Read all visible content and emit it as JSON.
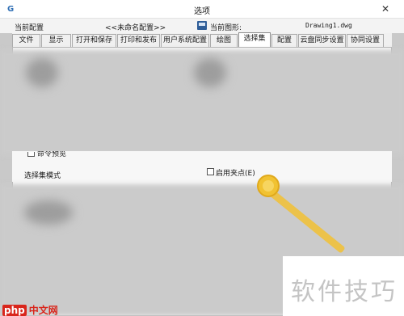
{
  "window": {
    "title": "选项",
    "close_glyph": "✕"
  },
  "profile": {
    "current_profile_label": "当前配置",
    "current_profile_value": "<<未命名配置>>",
    "current_drawing_label": "当前图形:",
    "current_drawing_value": "Drawing1.dwg"
  },
  "tabs": [
    {
      "label": "文件"
    },
    {
      "label": "显示"
    },
    {
      "label": "打开和保存"
    },
    {
      "label": "打印和发布"
    },
    {
      "label": "用户系统配置"
    },
    {
      "label": "绘图"
    },
    {
      "label": "选择集",
      "active": true
    },
    {
      "label": "配置"
    },
    {
      "label": "云盘同步设置"
    },
    {
      "label": "协同设置"
    }
  ],
  "selection": {
    "preview_label": "命令预览",
    "mode_section_label": "选择集模式",
    "enable_grips_label": "启用夹点(E)",
    "enable_grips_checked": false
  },
  "watermark": {
    "text": "软件技巧",
    "logo_badge": "php",
    "logo_suffix": "中文网"
  }
}
